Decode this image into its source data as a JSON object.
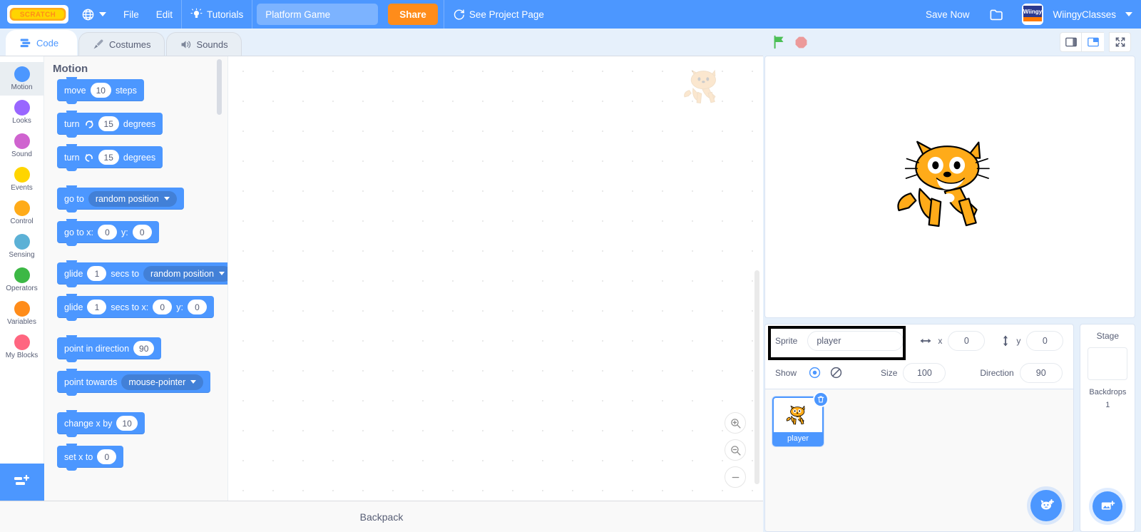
{
  "menu": {
    "logo_alt": "scratch-logo",
    "language_icon": "globe-icon",
    "file": "File",
    "edit": "Edit",
    "tutorials": "Tutorials",
    "tutorials_icon": "lightbulb-icon",
    "project_title": "Platform Game",
    "project_title_placeholder": "Project title",
    "share": "Share",
    "see_project_page": "See Project Page",
    "see_project_icon": "refresh-icon",
    "save_now": "Save Now",
    "folder_icon": "folder-icon",
    "username": "WiingyClasses",
    "avatar_label": "Wiingy"
  },
  "tabs": [
    {
      "label": "Code",
      "icon": "code-icon",
      "active": true
    },
    {
      "label": "Costumes",
      "icon": "paintbrush-icon",
      "active": false
    },
    {
      "label": "Sounds",
      "icon": "speaker-icon",
      "active": false
    }
  ],
  "categories": [
    {
      "label": "Motion",
      "color": "#4c97ff",
      "selected": true
    },
    {
      "label": "Looks",
      "color": "#9966ff",
      "selected": false
    },
    {
      "label": "Sound",
      "color": "#cf63cf",
      "selected": false
    },
    {
      "label": "Events",
      "color": "#ffd500",
      "selected": false
    },
    {
      "label": "Control",
      "color": "#ffab19",
      "selected": false
    },
    {
      "label": "Sensing",
      "color": "#5cb1d6",
      "selected": false
    },
    {
      "label": "Operators",
      "color": "#3cb845",
      "selected": false
    },
    {
      "label": "Variables",
      "color": "#ff8c1a",
      "selected": false
    },
    {
      "label": "My Blocks",
      "color": "#ff6680",
      "selected": false
    }
  ],
  "palette": {
    "header": "Motion",
    "blocks": [
      {
        "id": "move-steps",
        "parts": [
          {
            "t": "text",
            "v": "move"
          },
          {
            "t": "oval",
            "v": "10"
          },
          {
            "t": "text",
            "v": "steps"
          }
        ]
      },
      {
        "id": "turn-right",
        "parts": [
          {
            "t": "text",
            "v": "turn"
          },
          {
            "t": "icon",
            "v": "turn-right-icon"
          },
          {
            "t": "oval",
            "v": "15"
          },
          {
            "t": "text",
            "v": "degrees"
          }
        ]
      },
      {
        "id": "turn-left",
        "parts": [
          {
            "t": "text",
            "v": "turn"
          },
          {
            "t": "icon",
            "v": "turn-left-icon"
          },
          {
            "t": "oval",
            "v": "15"
          },
          {
            "t": "text",
            "v": "degrees"
          }
        ],
        "gap": true
      },
      {
        "id": "go-to",
        "parts": [
          {
            "t": "text",
            "v": "go to"
          },
          {
            "t": "drop",
            "v": "random position"
          }
        ]
      },
      {
        "id": "go-to-xy",
        "parts": [
          {
            "t": "text",
            "v": "go to x:"
          },
          {
            "t": "oval",
            "v": "0"
          },
          {
            "t": "text",
            "v": "y:"
          },
          {
            "t": "oval",
            "v": "0"
          }
        ],
        "gap": true
      },
      {
        "id": "glide-to",
        "parts": [
          {
            "t": "text",
            "v": "glide"
          },
          {
            "t": "oval",
            "v": "1"
          },
          {
            "t": "text",
            "v": "secs to"
          },
          {
            "t": "drop",
            "v": "random position"
          }
        ]
      },
      {
        "id": "glide-to-xy",
        "parts": [
          {
            "t": "text",
            "v": "glide"
          },
          {
            "t": "oval",
            "v": "1"
          },
          {
            "t": "text",
            "v": "secs to x:"
          },
          {
            "t": "oval",
            "v": "0"
          },
          {
            "t": "text",
            "v": "y:"
          },
          {
            "t": "oval",
            "v": "0"
          }
        ],
        "gap": true
      },
      {
        "id": "point-in-direction",
        "parts": [
          {
            "t": "text",
            "v": "point in direction"
          },
          {
            "t": "oval",
            "v": "90"
          }
        ]
      },
      {
        "id": "point-towards",
        "parts": [
          {
            "t": "text",
            "v": "point towards"
          },
          {
            "t": "drop",
            "v": "mouse-pointer"
          }
        ],
        "gap": true
      },
      {
        "id": "change-x-by",
        "parts": [
          {
            "t": "text",
            "v": "change x by"
          },
          {
            "t": "oval",
            "v": "10"
          }
        ]
      },
      {
        "id": "set-x-to",
        "parts": [
          {
            "t": "text",
            "v": "set x to"
          },
          {
            "t": "oval",
            "v": "0"
          }
        ]
      }
    ]
  },
  "workspace": {
    "zoom_in": "zoom-in-icon",
    "zoom_out": "zoom-out-icon",
    "zoom_reset": "zoom-reset-icon",
    "watermark": "scratch-cat-watermark"
  },
  "backpack": {
    "label": "Backpack"
  },
  "stage_controls": {
    "green_flag": "green-flag-icon",
    "stop": "stop-sign-icon",
    "small_stage": "small-stage-icon",
    "large_stage": "large-stage-icon",
    "fullscreen": "fullscreen-icon",
    "selected_size": "large"
  },
  "sprite_info": {
    "sprite_label": "Sprite",
    "sprite_name": "player",
    "x_label": "x",
    "x_value": "0",
    "y_label": "y",
    "y_value": "0",
    "show_label": "Show",
    "size_label": "Size",
    "size_value": "100",
    "direction_label": "Direction",
    "direction_value": "90",
    "show_icon": "eye-visible-icon",
    "hide_icon": "eye-hidden-icon",
    "x_icon": "horizontal-arrows-icon",
    "y_icon": "vertical-arrows-icon",
    "highlighted": true
  },
  "sprites": [
    {
      "name": "player",
      "selected": true,
      "delete_icon": "trash-icon",
      "thumb": "scratch-cat"
    }
  ],
  "add_sprite_button": "add-sprite-icon",
  "stage_panel": {
    "title": "Stage",
    "backdrops_label": "Backdrops",
    "backdrops_count": "1",
    "add_backdrop_icon": "add-backdrop-icon"
  },
  "extension_button": "add-extension-icon",
  "colors": {
    "brand_blue": "#4c97ff",
    "share_orange": "#ff8c1a",
    "motion_blue": "#4c97ff",
    "highlight_box": "#000000"
  }
}
